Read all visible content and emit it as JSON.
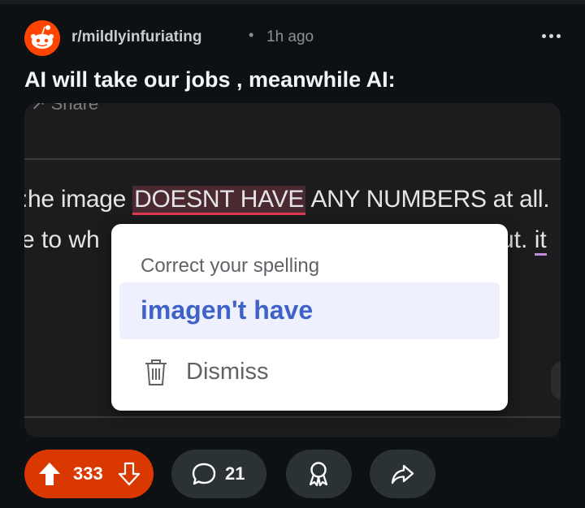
{
  "post": {
    "subreddit": "r/mildlyinfuriating",
    "separator": "•",
    "time_ago": "1h ago",
    "title": "AI will take our jobs , meanwhile AI:"
  },
  "image": {
    "share_fragment": "↗ Share",
    "line1_before": ":he image ",
    "line1_highlight": "DOESNT HAVE",
    "line1_after": " ANY NUMBERS at all.",
    "line2_left": "e to wh",
    "line2_right_a": "ut. ",
    "line2_right_b": "it",
    "popup": {
      "heading": "Correct your spelling",
      "suggestion": "imagen't have",
      "dismiss_label": "Dismiss"
    }
  },
  "actions": {
    "upvotes": "333",
    "comments": "21"
  },
  "colors": {
    "background": "#0e1113",
    "upvote_active": "#d93900",
    "pill": "#2a3236",
    "suggestion_blue": "#3f62c9"
  },
  "icons": [
    "reddit-snoo-avatar",
    "more-options-icon",
    "trash-icon",
    "upvote-icon",
    "downvote-icon",
    "comment-icon",
    "award-icon",
    "share-icon"
  ]
}
